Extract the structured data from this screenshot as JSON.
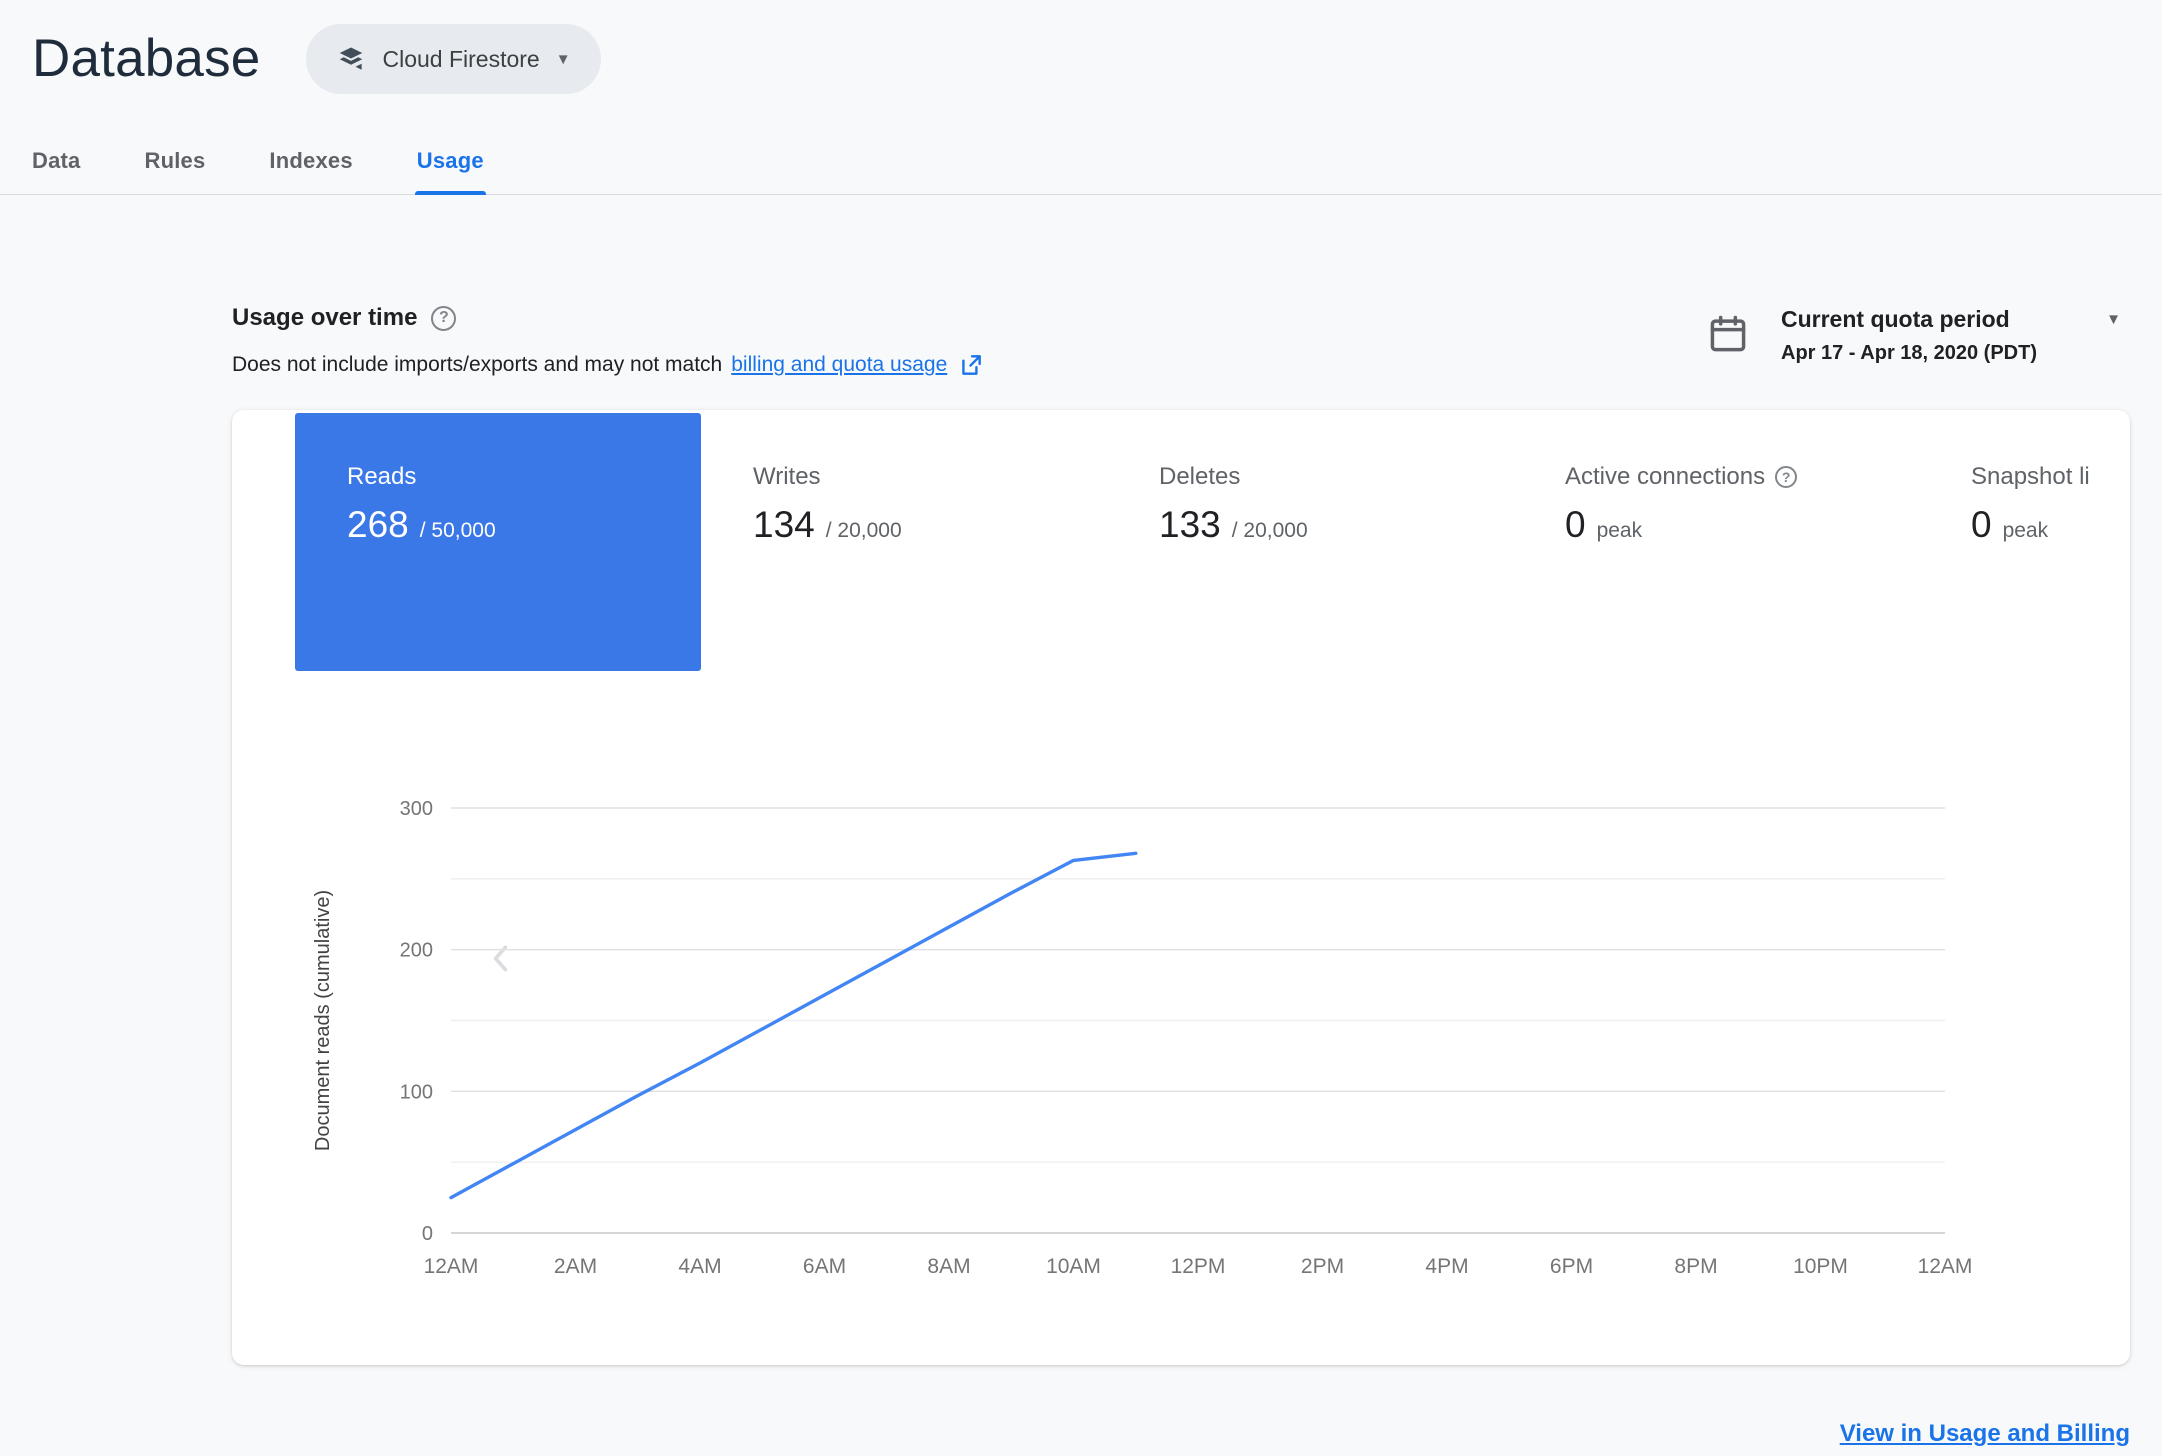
{
  "header": {
    "title": "Database",
    "product_selector": {
      "label": "Cloud Firestore"
    }
  },
  "tabs": [
    {
      "label": "Data"
    },
    {
      "label": "Rules"
    },
    {
      "label": "Indexes"
    },
    {
      "label": "Usage"
    }
  ],
  "usage_header": {
    "title": "Usage over time",
    "description_prefix": "Does not include imports/exports and may not match ",
    "description_link": "billing and quota usage",
    "period_label": "Current quota period",
    "period_range": "Apr 17 - Apr 18, 2020 (PDT)"
  },
  "metric_tiles": [
    {
      "name": "Reads",
      "value": "268",
      "suffix": "/ 50,000"
    },
    {
      "name": "Writes",
      "value": "134",
      "suffix": "/ 20,000"
    },
    {
      "name": "Deletes",
      "value": "133",
      "suffix": "/ 20,000"
    },
    {
      "name": "Active connections",
      "value": "0",
      "suffix": "peak"
    },
    {
      "name": "Snapshot listeners",
      "value": "0",
      "suffix": "peak"
    }
  ],
  "footer": {
    "billing_link": "View in Usage and Billing"
  },
  "icons": {
    "help": "?",
    "caret_down": "▼"
  },
  "colors": {
    "accent_blue": "#1a73e8",
    "tile_blue": "#3b78e7",
    "line_blue": "#4285f4",
    "grid_major": "#e0e0e0",
    "grid_minor": "#efefef",
    "axis_zero": "#c9c9c9",
    "tick_label": "#757575"
  },
  "chart_data": {
    "type": "line",
    "title": "",
    "xlabel": "",
    "ylabel": "Document reads (cumulative)",
    "ylim": [
      0,
      300
    ],
    "y_ticks": [
      0,
      100,
      200,
      300
    ],
    "gridline_step": 50,
    "x_hours_span": 24,
    "x_ticks": [
      "12AM",
      "2AM",
      "4AM",
      "6AM",
      "8AM",
      "10AM",
      "12PM",
      "2PM",
      "4PM",
      "6PM",
      "8PM",
      "10PM",
      "12AM"
    ],
    "grid": true,
    "legend": "none",
    "series": [
      {
        "name": "Document reads (cumulative)",
        "x_hours": [
          0,
          1,
          2,
          3,
          4,
          5,
          6,
          7,
          8,
          9,
          10,
          11
        ],
        "values": [
          25,
          49,
          73,
          97,
          120,
          144,
          168,
          192,
          216,
          240,
          263,
          268
        ]
      }
    ]
  }
}
